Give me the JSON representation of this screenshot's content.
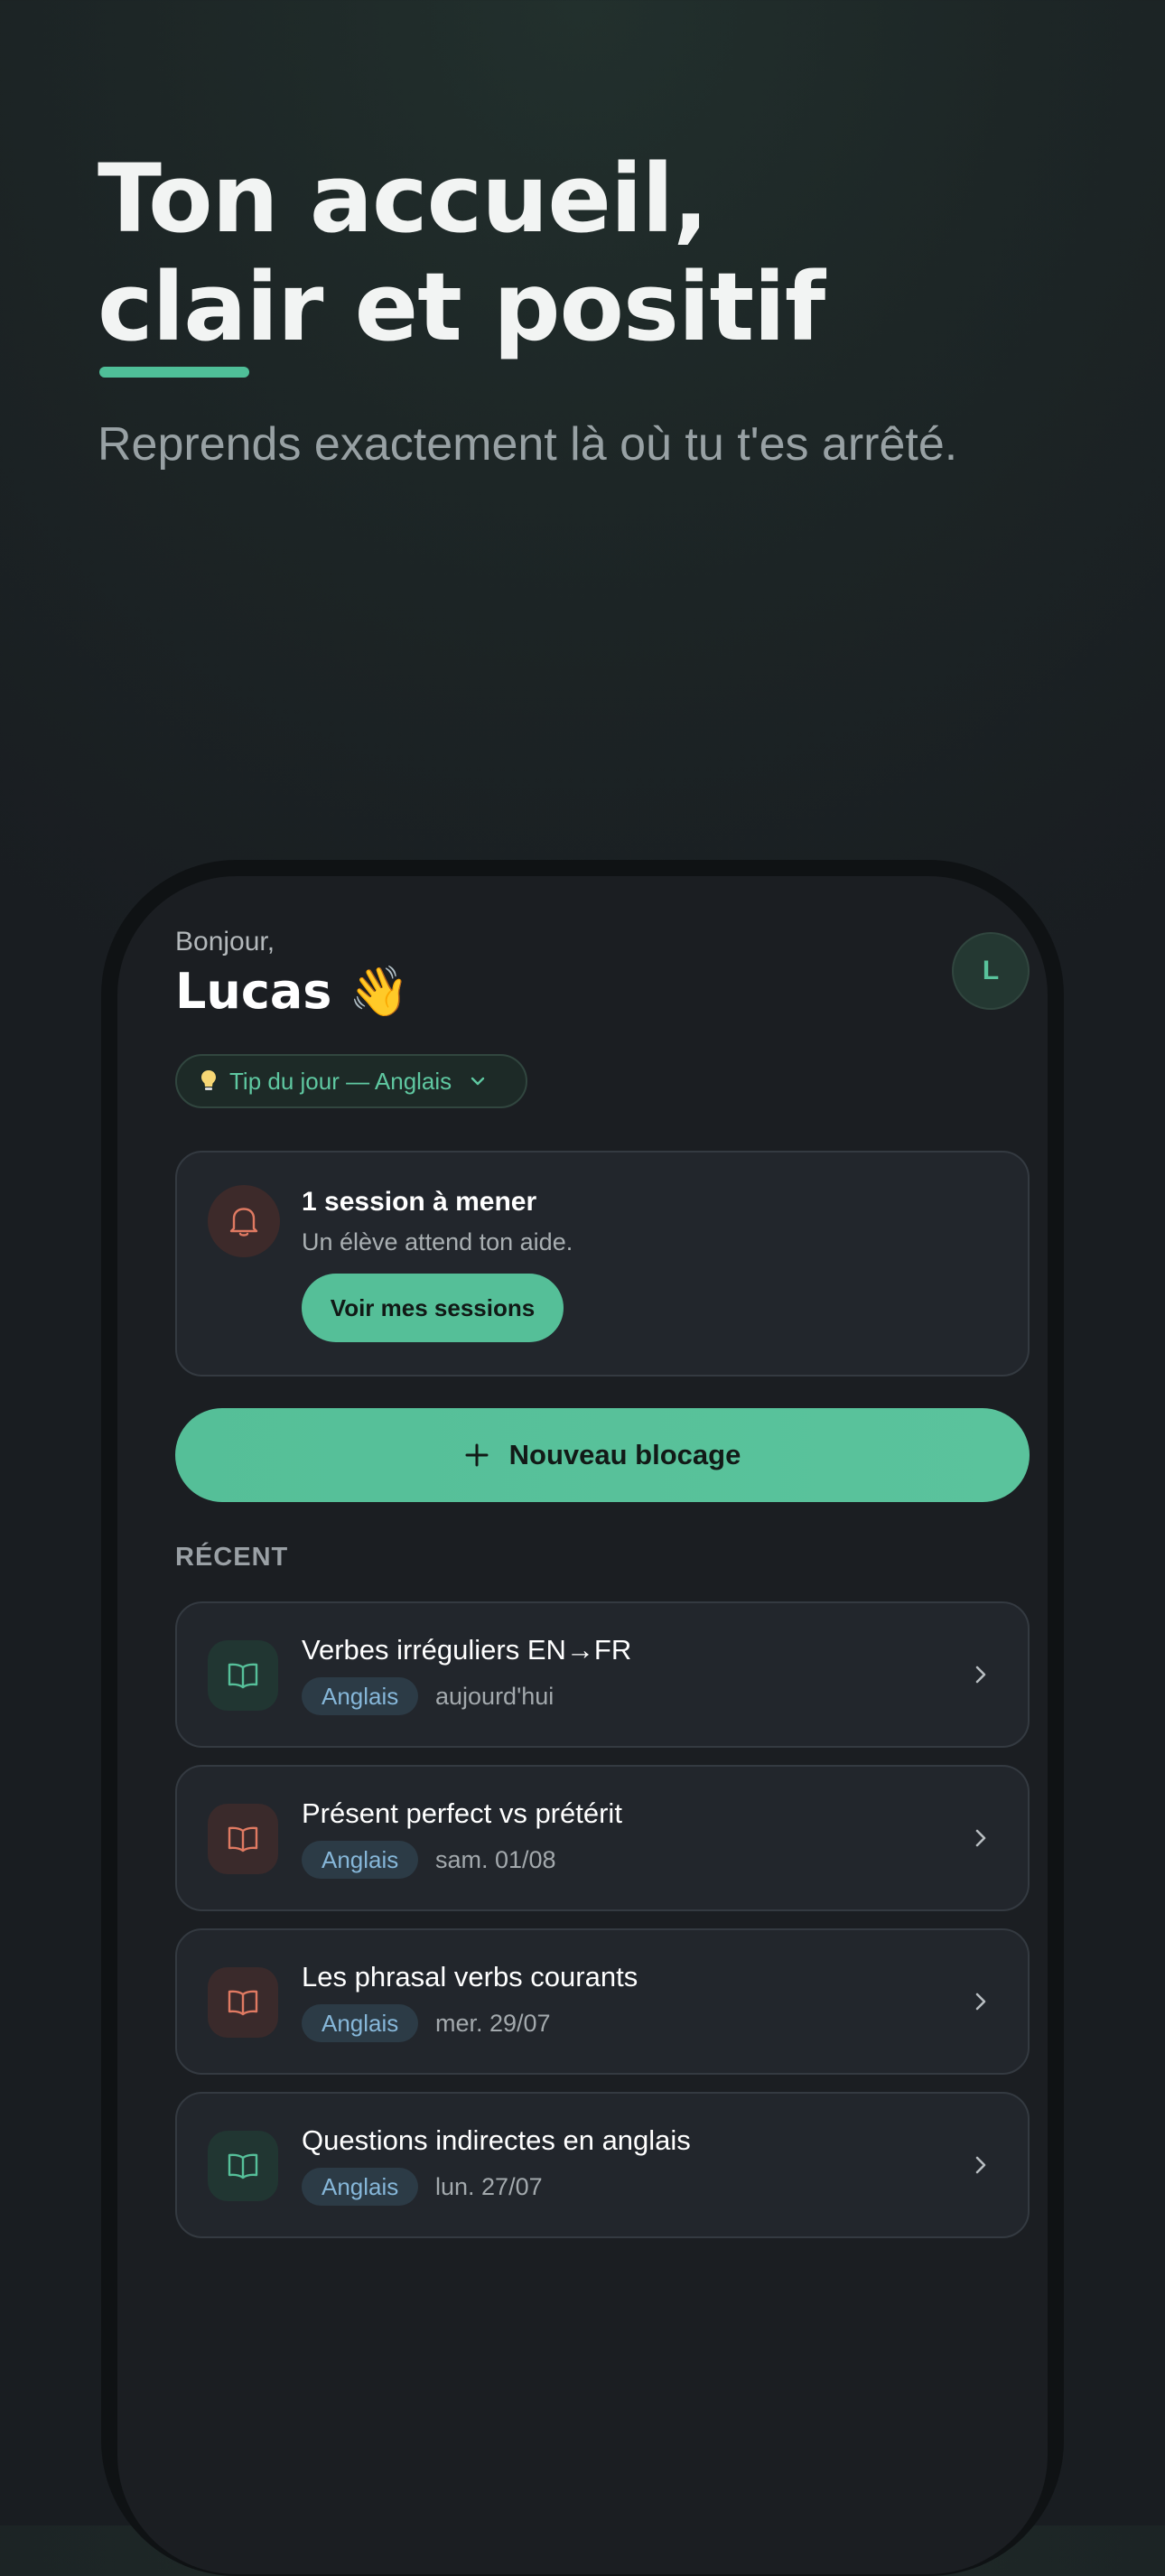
{
  "hero": {
    "title_line1": "Ton accueil,",
    "title_line2": "clair et positif",
    "subtitle": "Reprends exactement là où tu t'es arrêté."
  },
  "header": {
    "greeting": "Bonjour,",
    "user_name": "Lucas 👋",
    "avatar_initial": "L"
  },
  "tip": {
    "label": "Tip du jour — Anglais"
  },
  "sessions_card": {
    "title": "1 session à mener",
    "subtitle": "Un élève attend ton aide.",
    "button_label": "Voir mes sessions"
  },
  "new_blocker": {
    "label": "Nouveau blocage"
  },
  "recent": {
    "section_label": "RÉCENT",
    "items": [
      {
        "title": "Verbes irréguliers EN→FR",
        "tag": "Anglais",
        "date": "aujourd'hui",
        "icon_color": "green"
      },
      {
        "title": "Présent perfect vs prétérit",
        "tag": "Anglais",
        "date": "sam. 01/08",
        "icon_color": "red"
      },
      {
        "title": "Les phrasal verbs courants",
        "tag": "Anglais",
        "date": "mer. 29/07",
        "icon_color": "red"
      },
      {
        "title": "Questions indirectes en anglais",
        "tag": "Anglais",
        "date": "lun. 27/07",
        "icon_color": "green"
      }
    ]
  },
  "colors": {
    "accent": "#55bf98",
    "background": "#1b1e22",
    "card": "#22262c",
    "alert": "#e07a62",
    "tag_text": "#86b7d9"
  },
  "icons": [
    "lightbulb-icon",
    "chevron-down-icon",
    "bell-icon",
    "plus-icon",
    "book-open-icon",
    "chevron-right-icon"
  ]
}
